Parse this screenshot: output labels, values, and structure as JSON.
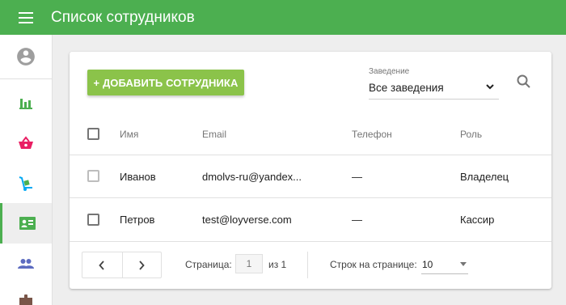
{
  "header": {
    "title": "Список сотрудников"
  },
  "sidebar": {
    "items": [
      {
        "name": "avatar",
        "icon": "account-circle-icon",
        "color": "#9e9e9e"
      },
      {
        "name": "reports",
        "icon": "bar-chart-icon",
        "color": "#4caf50"
      },
      {
        "name": "items",
        "icon": "basket-icon",
        "color": "#e91e63"
      },
      {
        "name": "inventory",
        "icon": "dolly-icon",
        "color": "#03a9f4"
      },
      {
        "name": "employees",
        "icon": "badge-icon",
        "color": "#4caf50",
        "active": true
      },
      {
        "name": "customers",
        "icon": "people-icon",
        "color": "#5c6bc0"
      },
      {
        "name": "settings",
        "icon": "puzzle-icon",
        "color": "#795548"
      }
    ]
  },
  "toolbar": {
    "add_label": "+ ДОБАВИТЬ СОТРУДНИКА",
    "venue_label": "Заведение",
    "venue_value": "Все заведения"
  },
  "table": {
    "columns": [
      "Имя",
      "Email",
      "Телефон",
      "Роль"
    ],
    "rows": [
      {
        "name": "Иванов",
        "email": "dmolvs-ru@yandex...",
        "phone": "—",
        "role": "Владелец"
      },
      {
        "name": "Петров",
        "email": "test@loyverse.com",
        "phone": "—",
        "role": "Кассир"
      }
    ]
  },
  "pagination": {
    "page_label": "Страница:",
    "page_value": "1",
    "page_total": "из 1",
    "rows_label": "Строк на странице:",
    "rows_value": "10"
  },
  "colors": {
    "brand": "#4caf50",
    "accent": "#8bc34a"
  }
}
